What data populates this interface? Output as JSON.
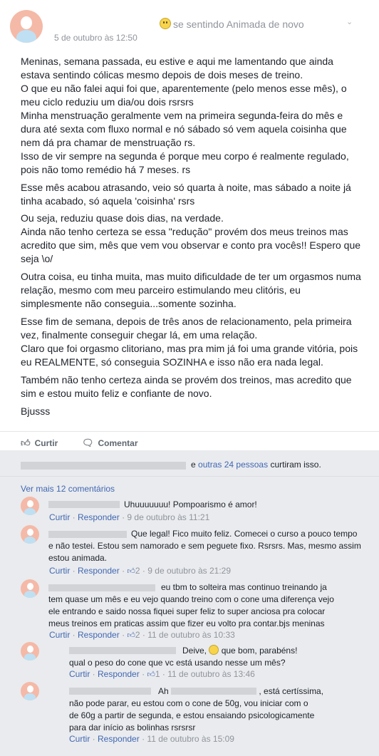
{
  "post": {
    "feeling": "se sentindo Animada de novo",
    "date": "5 de outubro às 12:50",
    "paragraphs": [
      "Meninas, semana passada, eu estive e aqui me lamentando que ainda estava sentindo cólicas mesmo depois de dois meses de treino.",
      "O que eu não falei aqui foi que, aparentemente (pelo menos esse mês), o meu ciclo reduziu um dia/ou dois rsrsrs",
      "Minha menstruação geralmente vem na primeira segunda-feira do mês e dura até sexta com fluxo normal e nó sábado só vem aquela coisinha que nem dá pra chamar de menstruação rs.",
      "Isso de vir sempre na segunda é porque meu corpo é realmente regulado, pois não tomo remédio há 7 meses. rs",
      "Esse mês acabou atrasando, veio só quarta à noite, mas sábado a noite já tinha acabado, só aquela 'coisinha' rsrs",
      "Ou seja, reduziu quase dois dias, na verdade.",
      "Ainda não tenho certeza se essa \"redução\" provém dos meus treinos mas acredito que sim, mês que vem vou observar e conto pra vocês!! Espero que seja \\o/",
      "Outra coisa, eu tinha muita, mas muito dificuldade de ter um orgasmos numa relação, mesmo com meu parceiro estimulando meu clitóris, eu simplesmente não conseguia...somente sozinha.",
      "Esse fim de semana, depois de três anos de relacionamento, pela primeira vez, finalmente conseguir chegar lá, em uma relação.",
      "Claro que foi orgasmo clitoriano, mas pra mim já foi uma grande vitória, pois eu REALMENTE, só conseguia SOZINHA e isso não era nada legal.",
      "Também não tenho certeza ainda se provém dos treinos, mas acredito que sim e estou muito feliz e confiante de novo.",
      "Bjusss"
    ],
    "like_label": "Curtir",
    "comment_label": "Comentar"
  },
  "likes": {
    "prefix": "e",
    "others": "outras 24 pessoas",
    "suffix": "curtiram isso."
  },
  "more_comments": "Ver mais 12 comentários",
  "comments": [
    {
      "text": "Uhuuuuuuu! Pompoarismo é amor!",
      "like": "Curtir",
      "reply": "Responder",
      "count": "",
      "time": "9 de outubro às 11:21"
    },
    {
      "text": "Que legal! Fico muito feliz. Comecei o curso a pouco tempo e não testei. Estou sem namorado e sem peguete fixo. Rsrsrs. Mas, mesmo assim estou animada.",
      "like": "Curtir",
      "reply": "Responder",
      "count": "2",
      "time": "9 de outubro às 21:29"
    },
    {
      "text": "eu tbm to solteira mas continuo treinando ja tem quase um mês e eu vejo quando treino com o cone uma diferença vejo ele entrando e saido nossa fiquei super feliz to super anciosa pra colocar meus treinos em praticas assim que fizer eu volto pra contar.bjs meninas",
      "like": "Curtir",
      "reply": "Responder",
      "count": "2",
      "time": "11 de outubro às 10:33"
    },
    {
      "text_a": "Deive,",
      "text_b": "que bom, parabéns!",
      "text_c": "qual o peso do cone que vc está usando nesse um mês?",
      "like": "Curtir",
      "reply": "Responder",
      "count": "1",
      "time": "11 de outubro às 13:46"
    },
    {
      "text_a": "Ah",
      "text_b": ", está certíssima,",
      "text_c": "não pode parar, eu estou com o cone de 50g, vou iniciar com o de 60g a partir de segunda, e estou ensaiando psicologicamente para dar início as bolinhas rsrsrsr",
      "like": "Curtir",
      "reply": "Responder",
      "count": "",
      "time": "11 de outubro às 15:09"
    }
  ],
  "colors": {
    "link": "#4267b2",
    "meta": "#90949c",
    "background": "#e9ebee"
  }
}
